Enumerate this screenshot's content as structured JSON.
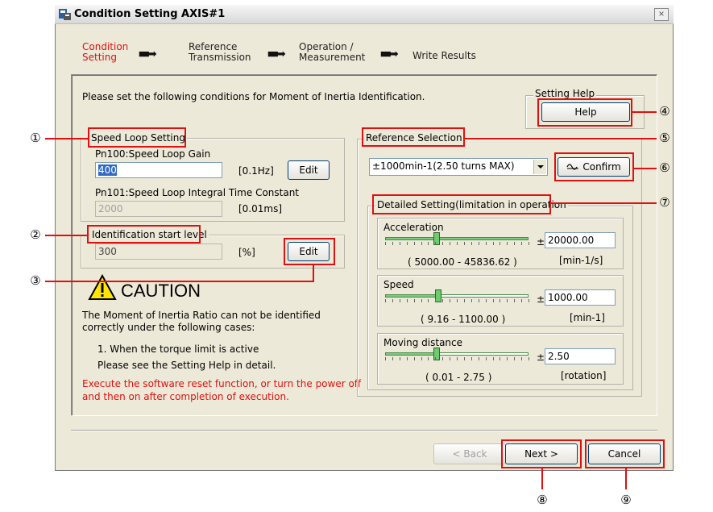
{
  "window": {
    "title": "Condition Setting AXIS#1",
    "close_label": "×"
  },
  "steps": [
    {
      "line1": "Condition",
      "line2": "Setting"
    },
    {
      "line1": "Reference",
      "line2": "Transmission"
    },
    {
      "line1": "Operation /",
      "line2": "Measurement"
    },
    {
      "line1": "Write Results",
      "line2": ""
    }
  ],
  "intro": "Please set the following conditions for Moment of Inertia Identification.",
  "setting_help": {
    "label": "Setting Help",
    "button": "Help"
  },
  "speed_loop": {
    "label": "Speed Loop Setting",
    "gain_label": "Pn100:Speed Loop Gain",
    "gain_value": "400",
    "gain_unit": "[0.1Hz]",
    "edit_label": "Edit",
    "integral_label": "Pn101:Speed Loop Integral Time Constant",
    "integral_value": "2000",
    "integral_unit": "[0.01ms]"
  },
  "identification": {
    "label": "Identification start level",
    "value": "300",
    "unit": "[%]",
    "edit_label": "Edit"
  },
  "caution": {
    "title": "CAUTION",
    "line1": "The Moment of Inertia Ratio can not be identified",
    "line2": "correctly under the following cases:",
    "item1": "1. When the torque limit is active",
    "item2": "Please see the Setting Help in detail.",
    "red1": "Execute the software reset function, or turn the power off",
    "red2": "and then on after completion of execution."
  },
  "reference": {
    "label": "Reference Selection",
    "selected": "±1000min-1(2.50 turns MAX)",
    "confirm_label": "Confirm"
  },
  "detailed": {
    "label": "Detailed Setting(limitation in operation",
    "acceleration": {
      "label": "Acceleration",
      "value": "20000.00",
      "range": "( 5000.00 - 45836.62 )",
      "unit": "[min-1/s]",
      "level": 0.36
    },
    "speed": {
      "label": "Speed",
      "value": "1000.00",
      "range": "( 9.16 - 1100.00 )",
      "unit": "[min-1]",
      "level": 0.37
    },
    "distance": {
      "label": "Moving distance",
      "value": "2.50",
      "range": "( 0.01 - 2.75 )",
      "unit": "[rotation]",
      "level": 0.36
    },
    "pm": "±"
  },
  "footer": {
    "back": "< Back",
    "next": "Next >",
    "cancel": "Cancel"
  },
  "callouts": {
    "c1": "①",
    "c2": "②",
    "c3": "③",
    "c4": "④",
    "c5": "⑤",
    "c6": "⑥",
    "c7": "⑦",
    "c8": "⑧",
    "c9": "⑨"
  },
  "colors": {
    "annotation": "#e01010",
    "window_bg": "#ece9d8",
    "step_active": "#e01010"
  },
  "icons": {
    "app": "app-window-icon",
    "warning": "warning-triangle-icon",
    "confirm": "waveform-icon",
    "dropdown": "dropdown-arrow-icon"
  }
}
